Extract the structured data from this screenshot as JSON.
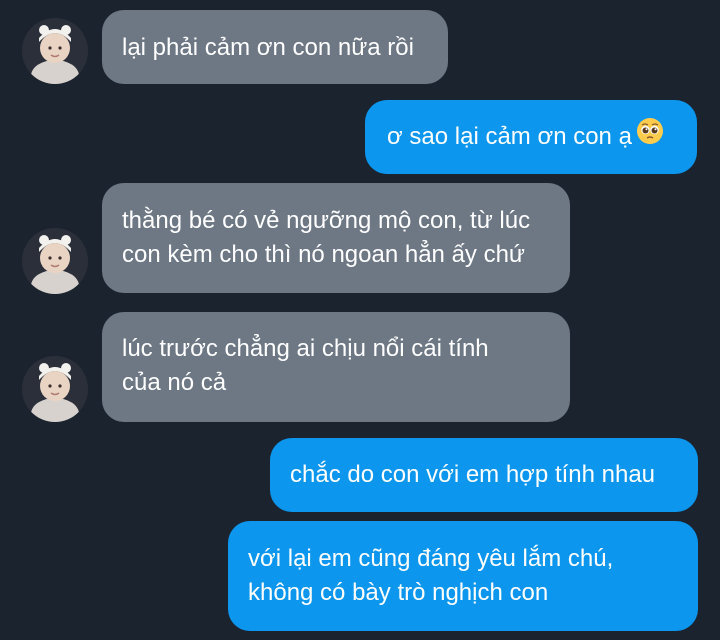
{
  "conversation": {
    "messages": [
      {
        "direction": "incoming",
        "text_lines": [
          "lại phải cảm ơn con nữa rồi"
        ]
      },
      {
        "direction": "outgoing",
        "text_lines": [
          "ơ sao lại cảm ơn con ạ"
        ],
        "emoji": "pleading-face"
      },
      {
        "direction": "incoming",
        "text_lines": [
          "thằng bé có vẻ ngưỡng mộ con, từ lúc",
          "con kèm cho thì nó ngoan hẳn ấy chứ"
        ]
      },
      {
        "direction": "incoming",
        "text_lines": [
          "lúc trước chẳng ai chịu nổi cái tính",
          "của nó cả"
        ]
      },
      {
        "direction": "outgoing",
        "text_lines": [
          "chắc do con với em hợp tính nhau"
        ]
      },
      {
        "direction": "outgoing",
        "text_lines": [
          "với lại em cũng đáng yêu lắm chú,",
          "không có bày trò nghịch con"
        ]
      }
    ]
  },
  "colors": {
    "background": "#1b232e",
    "incoming_bubble": "#6d7884",
    "outgoing_bubble": "#0d96ee",
    "text": "#ffffff"
  },
  "icons": {
    "avatar": "baby-avatar-icon",
    "emoji": "pleading-face-icon"
  }
}
